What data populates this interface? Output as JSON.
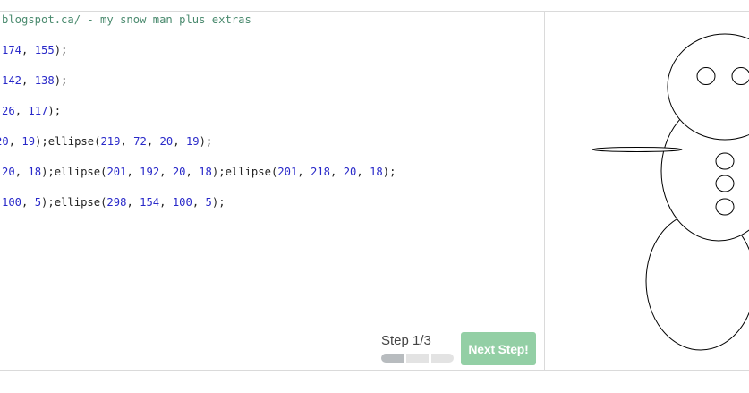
{
  "editor": {
    "lines": [
      [
        {
          "t": "blogspot.ca/ - my snow man plus extras",
          "c": "com"
        }
      ],
      [
        {
          "t": "174",
          "c": "num"
        },
        {
          "t": ", ",
          "c": ""
        },
        {
          "t": "155",
          "c": "num"
        },
        {
          "t": ");",
          "c": ""
        }
      ],
      [
        {
          "t": "142",
          "c": "num"
        },
        {
          "t": ", ",
          "c": ""
        },
        {
          "t": "138",
          "c": "num"
        },
        {
          "t": ");",
          "c": ""
        }
      ],
      [
        {
          "t": "26",
          "c": "num"
        },
        {
          "t": ", ",
          "c": ""
        },
        {
          "t": "117",
          "c": "num"
        },
        {
          "t": ");",
          "c": ""
        }
      ],
      [
        {
          "t": "20",
          "c": "num"
        },
        {
          "t": ", ",
          "c": ""
        },
        {
          "t": "19",
          "c": "num"
        },
        {
          "t": ");ellipse(",
          "c": ""
        },
        {
          "t": "219",
          "c": "num"
        },
        {
          "t": ", ",
          "c": ""
        },
        {
          "t": "72",
          "c": "num"
        },
        {
          "t": ", ",
          "c": ""
        },
        {
          "t": "20",
          "c": "num"
        },
        {
          "t": ", ",
          "c": ""
        },
        {
          "t": "19",
          "c": "num"
        },
        {
          "t": ");",
          "c": ""
        }
      ],
      [
        {
          "t": "20",
          "c": "num"
        },
        {
          "t": ", ",
          "c": ""
        },
        {
          "t": "18",
          "c": "num"
        },
        {
          "t": ");ellipse(",
          "c": ""
        },
        {
          "t": "201",
          "c": "num"
        },
        {
          "t": ", ",
          "c": ""
        },
        {
          "t": "192",
          "c": "num"
        },
        {
          "t": ", ",
          "c": ""
        },
        {
          "t": "20",
          "c": "num"
        },
        {
          "t": ", ",
          "c": ""
        },
        {
          "t": "18",
          "c": "num"
        },
        {
          "t": ");ellipse(",
          "c": ""
        },
        {
          "t": "201",
          "c": "num"
        },
        {
          "t": ", ",
          "c": ""
        },
        {
          "t": "218",
          "c": "num"
        },
        {
          "t": ", ",
          "c": ""
        },
        {
          "t": "20",
          "c": "num"
        },
        {
          "t": ", ",
          "c": ""
        },
        {
          "t": "18",
          "c": "num"
        },
        {
          "t": ");",
          "c": ""
        }
      ],
      [
        {
          "t": "100",
          "c": "num"
        },
        {
          "t": ", ",
          "c": ""
        },
        {
          "t": "5",
          "c": "num"
        },
        {
          "t": ");ellipse(",
          "c": ""
        },
        {
          "t": "298",
          "c": "num"
        },
        {
          "t": ", ",
          "c": ""
        },
        {
          "t": "154",
          "c": "num"
        },
        {
          "t": ", ",
          "c": ""
        },
        {
          "t": "100",
          "c": "num"
        },
        {
          "t": ", ",
          "c": ""
        },
        {
          "t": "5",
          "c": "num"
        },
        {
          "t": ");",
          "c": ""
        }
      ]
    ]
  },
  "stepper": {
    "label": "Step 1/3",
    "current_step": 1,
    "total_steps": 3
  },
  "next_button": {
    "label": "Next Step!",
    "color": "#93cfa5"
  },
  "colors": {
    "comment": "#4a8a6e",
    "number": "#2929c9",
    "text": "#222222"
  }
}
